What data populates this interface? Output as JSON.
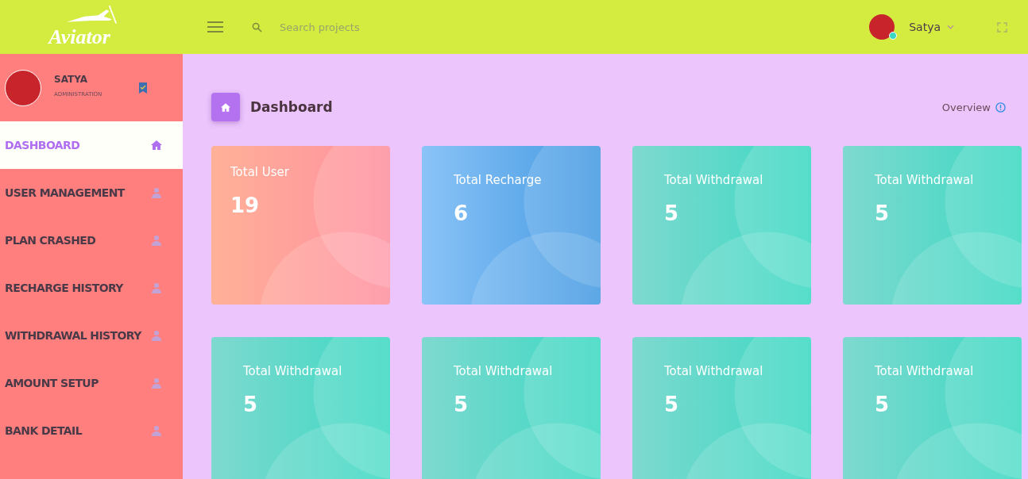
{
  "header": {
    "logo": "Aviator",
    "search": {
      "placeholder": "Search projects"
    },
    "user": {
      "name": "Satya",
      "online": true
    }
  },
  "sidebar": {
    "profile": {
      "name": "SATYA",
      "role": "ADMINISTRATION"
    },
    "items": [
      {
        "label": "DASHBOARD",
        "kind": "home",
        "selected": true
      },
      {
        "label": "USER MANAGEMENT",
        "kind": "user",
        "selected": false
      },
      {
        "label": "PLAN CRASHED",
        "kind": "user",
        "selected": false
      },
      {
        "label": "RECHARGE HISTORY",
        "kind": "user",
        "selected": false
      },
      {
        "label": "WITHDRAWAL HISTORY",
        "kind": "user",
        "selected": false
      },
      {
        "label": "AMOUNT SETUP",
        "kind": "user",
        "selected": false
      },
      {
        "label": "BANK DETAIL",
        "kind": "user",
        "selected": false
      }
    ]
  },
  "page": {
    "title": "Dashboard",
    "overview": "Overview"
  },
  "cards": [
    {
      "title": "Total User",
      "value": "19",
      "kind": "pink"
    },
    {
      "title": "Total Recharge",
      "value": "6",
      "kind": "blue"
    },
    {
      "title": "Total Withdrawal",
      "value": "5",
      "kind": "teal"
    },
    {
      "title": "Total Withdrawal",
      "value": "5",
      "kind": "teal"
    },
    {
      "title": "Total Withdrawal",
      "value": "5",
      "kind": "teal"
    },
    {
      "title": "Total Withdrawal",
      "value": "5",
      "kind": "teal"
    },
    {
      "title": "Total Withdrawal",
      "value": "5",
      "kind": "teal"
    },
    {
      "title": "Total Withdrawal",
      "value": "5",
      "kind": "teal"
    }
  ]
}
